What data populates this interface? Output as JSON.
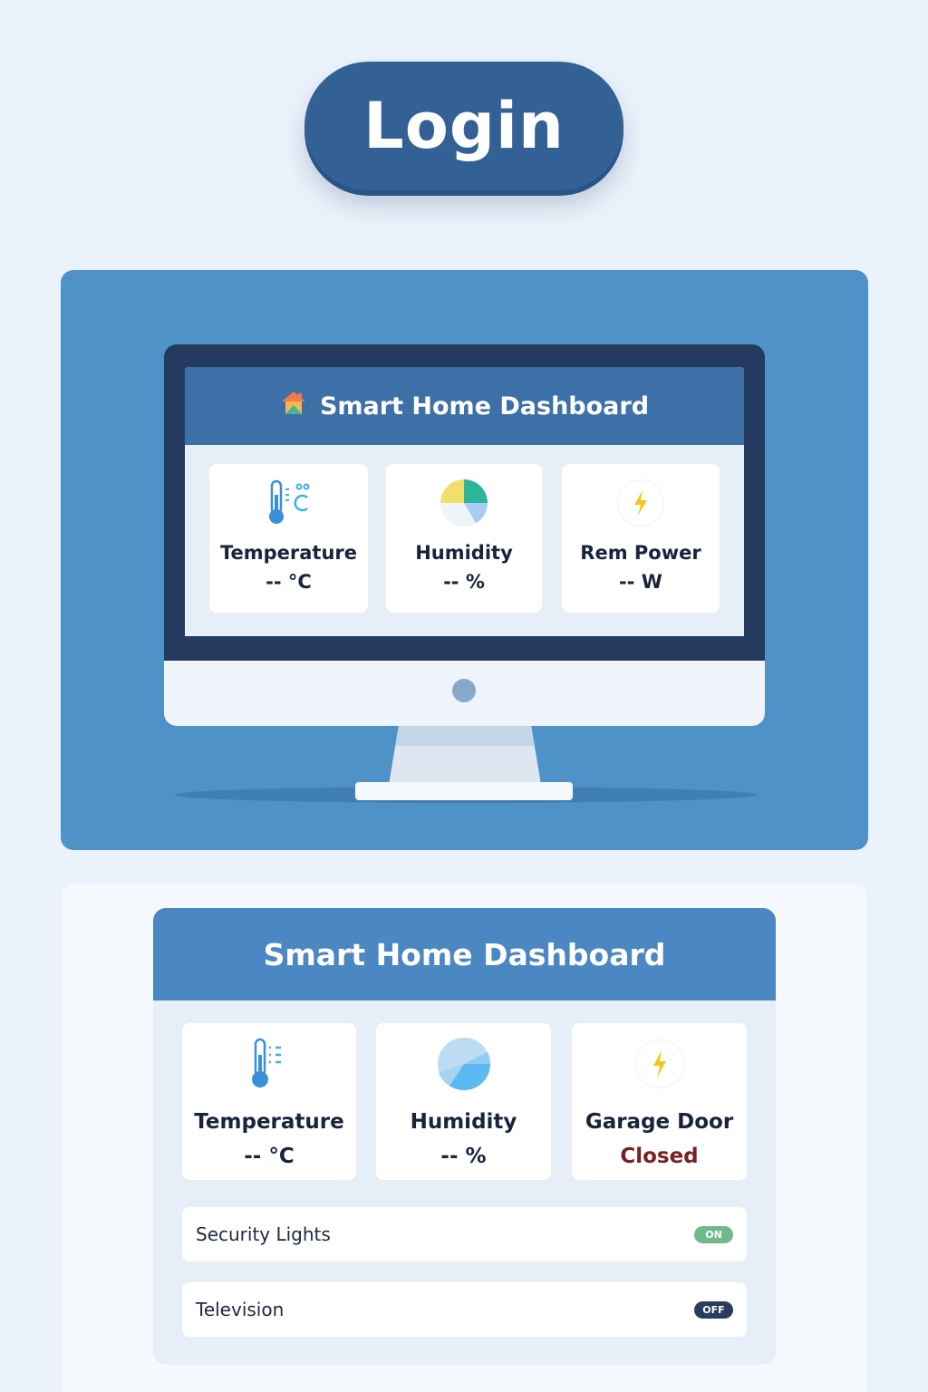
{
  "login": {
    "label": "Login"
  },
  "hero_dashboard": {
    "title": "Smart Home Dashboard",
    "cards": [
      {
        "icon": "thermometer-icon",
        "label": "Temperature",
        "value": "-- °C"
      },
      {
        "icon": "humidity-pie-icon",
        "label": "Humidity",
        "value": "-- %"
      },
      {
        "icon": "lightning-bolt-icon",
        "label": "Rem Power",
        "value": "-- W"
      }
    ]
  },
  "dashboard": {
    "title": "Smart Home Dashboard",
    "cards": [
      {
        "icon": "thermometer-icon",
        "label": "Temperature",
        "value": "-- °C"
      },
      {
        "icon": "humidity-pie-icon",
        "label": "Humidity",
        "value": "-- %"
      },
      {
        "icon": "lightning-bolt-icon",
        "label": "Garage Door",
        "value": "Closed"
      }
    ],
    "toggles": [
      {
        "label": "Security Lights",
        "state": "ON"
      },
      {
        "label": "Television",
        "state": "OFF"
      }
    ]
  },
  "colors": {
    "background": "#eaf2fb",
    "login_button": "#346195",
    "hero_panel": "#4e92c8",
    "dashboard_header": "#4b87c2",
    "status_closed": "#7a2020",
    "toggle_on": "#6fb98a",
    "toggle_off": "#2b3d5e"
  }
}
